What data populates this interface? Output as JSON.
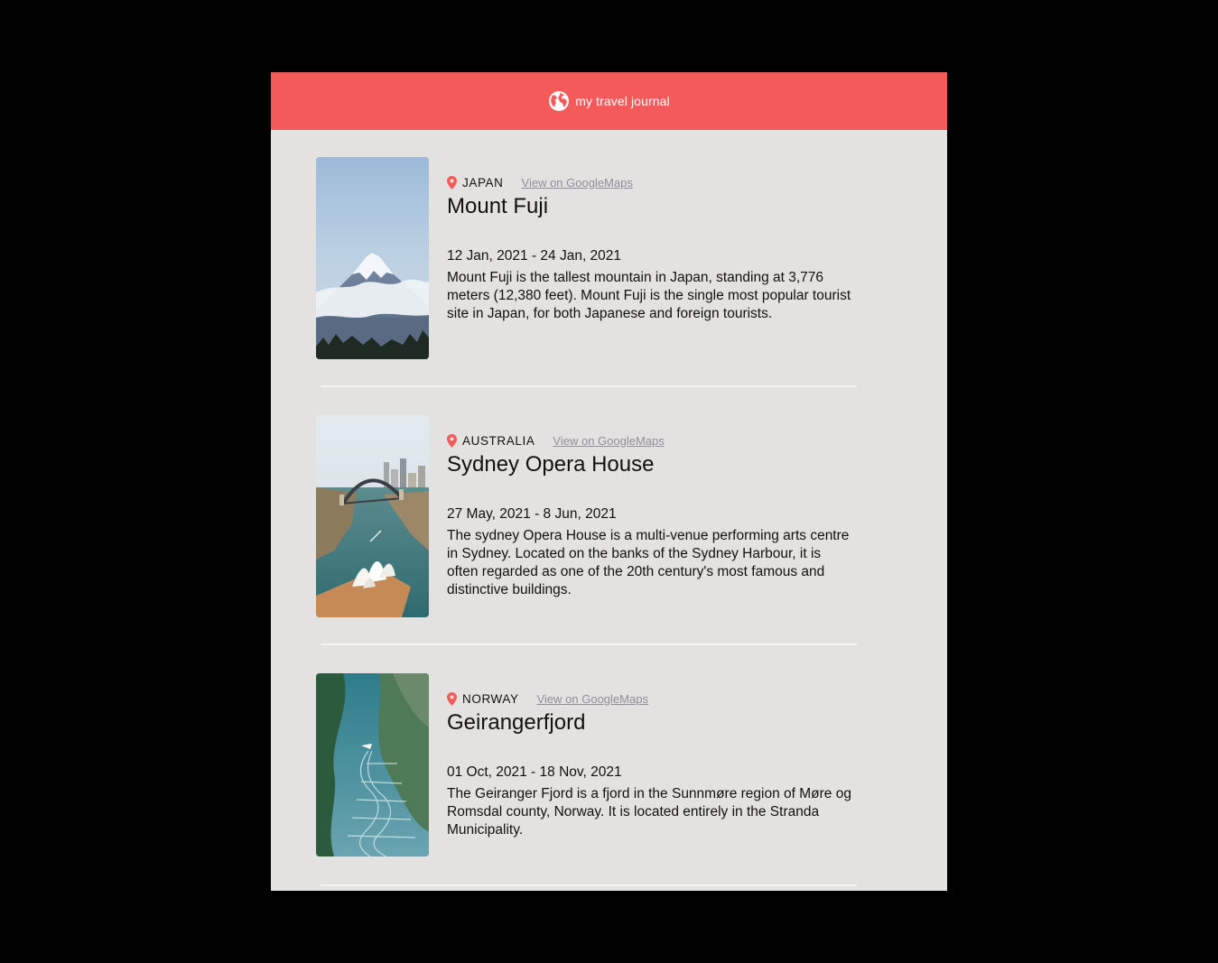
{
  "header": {
    "title": "my travel journal",
    "icon": "globe-icon",
    "background": "#f55a5a"
  },
  "map_link_label": "View on GoogleMaps",
  "entries": [
    {
      "country": "JAPAN",
      "title": "Mount Fuji",
      "dates": "12 Jan, 2021 - 24 Jan, 2021",
      "description": "Mount Fuji is the tallest mountain in Japan, standing at 3,776 meters (12,380 feet). Mount Fuji is the single most popular tourist site in Japan, for both Japanese and foreign tourists.",
      "image": "mountain-photo"
    },
    {
      "country": "AUSTRALIA",
      "title": "Sydney Opera House",
      "dates": "27 May, 2021 - 8 Jun, 2021",
      "description": "The sydney Opera House is a multi-venue performing arts centre in Sydney. Located on the banks of the Sydney Harbour, it is often regarded as one of the 20th century's most famous and distinctive buildings.",
      "image": "harbour-photo"
    },
    {
      "country": "NORWAY",
      "title": "Geirangerfjord",
      "dates": "01 Oct, 2021 - 18 Nov, 2021",
      "description": "The Geiranger Fjord is a fjord in the Sunnmøre region of Møre og Romsdal county, Norway. It is located entirely in the Stranda Municipality.",
      "image": "fjord-photo"
    }
  ],
  "colors": {
    "accent": "#f55a5a",
    "page_background": "#e3e2e0",
    "link": "#918e9b"
  }
}
